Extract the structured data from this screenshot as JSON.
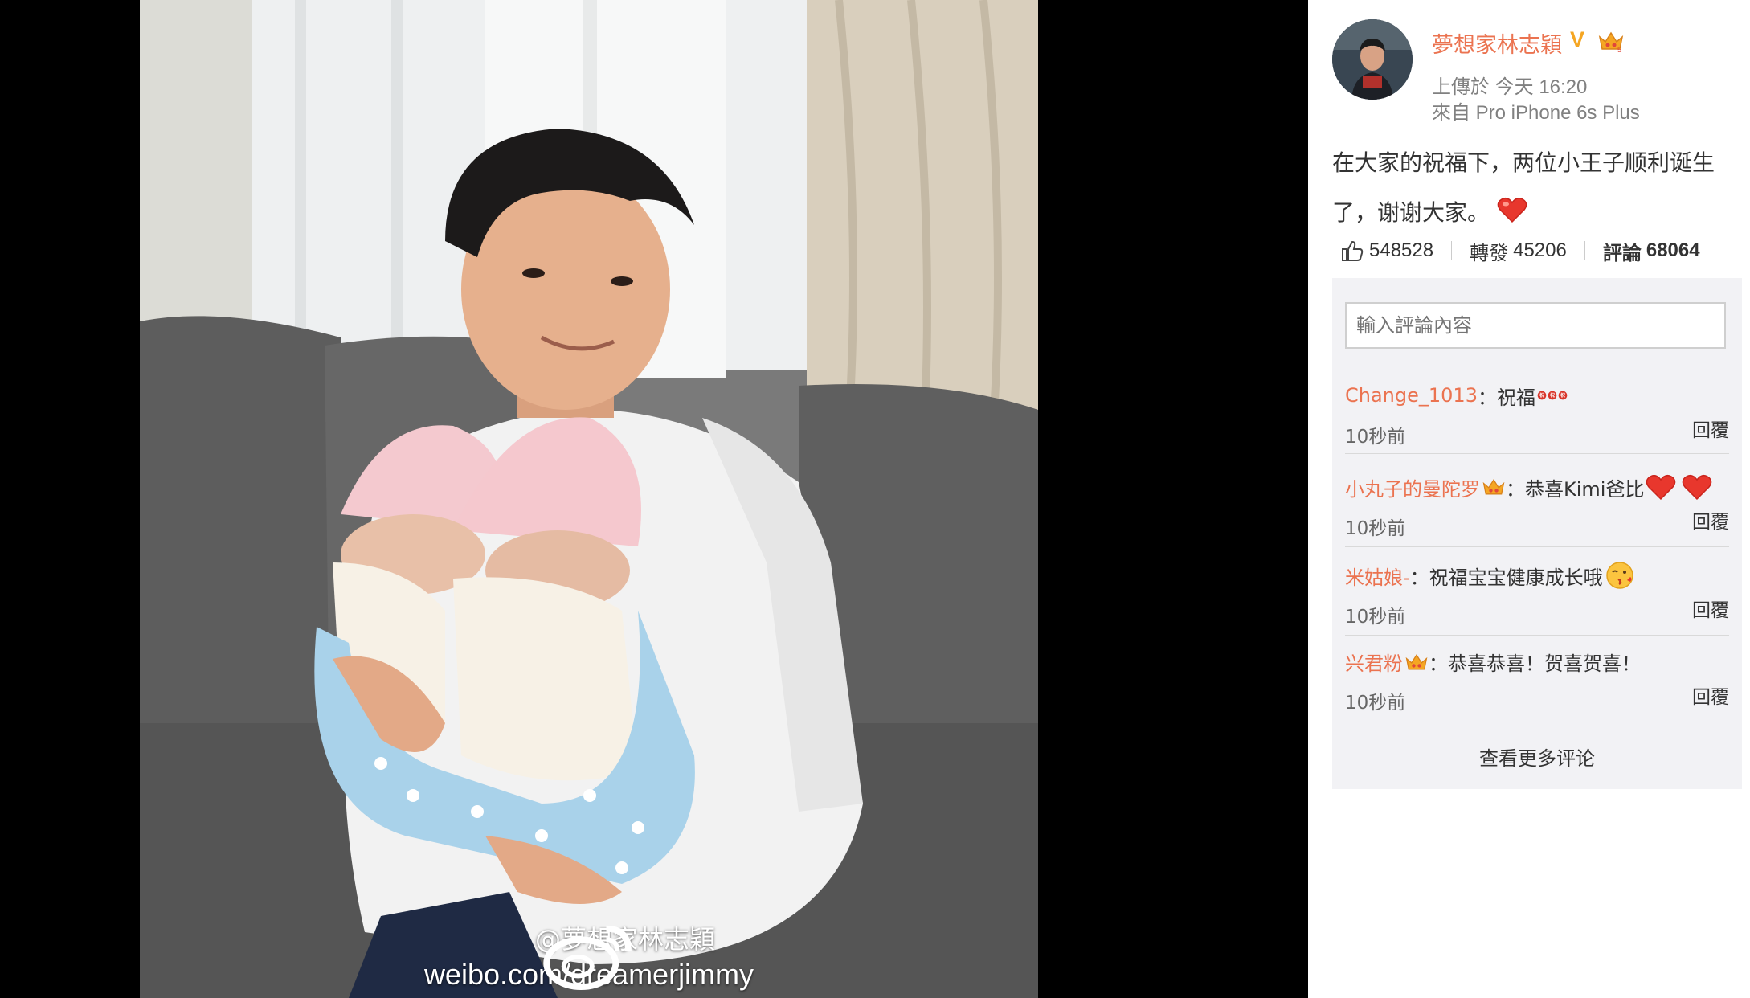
{
  "photo": {
    "watermark_handle": "@夢想家林志穎",
    "watermark_url": "weibo.com/dreamerjimmy",
    "weibo_logo_icon": "weibo-logo-icon"
  },
  "post": {
    "author": "夢想家林志穎",
    "verified_badge": "V",
    "upload_time": "上傳於 今天 16:20",
    "source": "來自 Pro iPhone 6s Plus",
    "text": "在大家的祝福下，两位小王子顺利诞生了，谢谢大家。",
    "text_emoji": "heart-icon"
  },
  "stats": {
    "likes": "548528",
    "reposts_label": "轉發",
    "reposts": "45206",
    "comments_label": "評論",
    "comments": "68064"
  },
  "comment_box": {
    "placeholder": "輸入評論內容"
  },
  "comments": [
    {
      "user": "Change_1013",
      "sep": "：",
      "text": "祝福",
      "emoji": "blessing-icon",
      "time": "10秒前",
      "reply": "回覆"
    },
    {
      "user": "小丸子的曼陀罗",
      "sep": "：",
      "text": "恭喜Kimi爸比",
      "emoji": "heart-icon",
      "time": "10秒前",
      "reply": "回覆"
    },
    {
      "user": "米姑娘-",
      "sep": "：",
      "text": "祝福宝宝健康成长哦",
      "emoji": "kiss-face-icon",
      "time": "10秒前",
      "reply": "回覆"
    },
    {
      "user": "兴君粉",
      "sep": "：",
      "text": "恭喜恭喜！贺喜贺喜！",
      "emoji": "",
      "time": "10秒前",
      "reply": "回覆"
    }
  ],
  "more_comments": "查看更多评论",
  "colors": {
    "accent": "#eb7350",
    "comment_bg": "#f2f2f5",
    "verified": "#f5a623"
  }
}
